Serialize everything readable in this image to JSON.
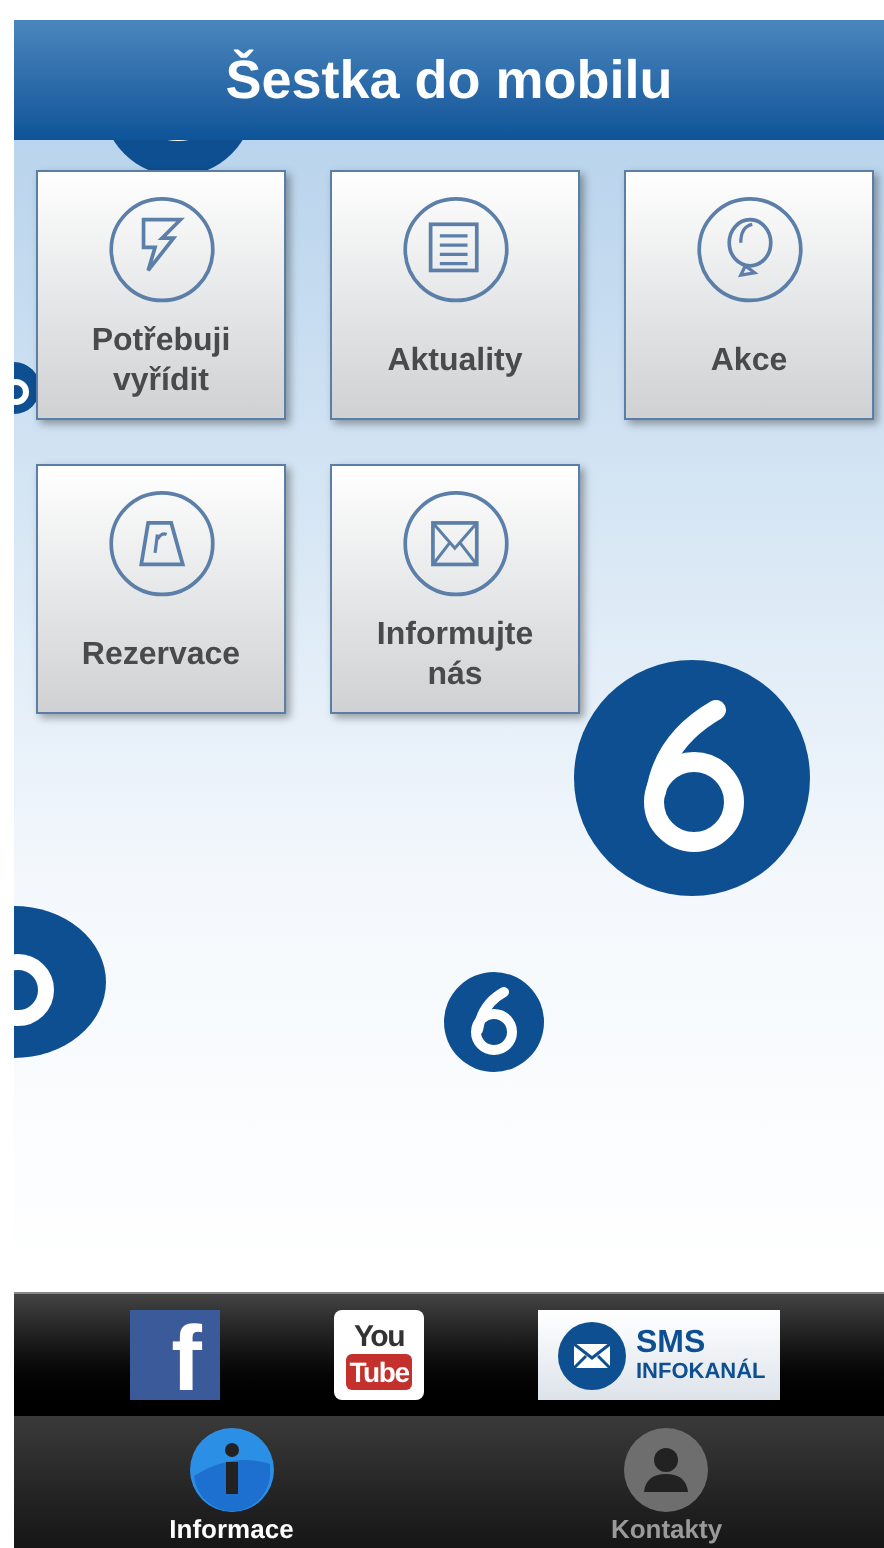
{
  "header": {
    "title": "Šestka do mobilu"
  },
  "tiles": [
    {
      "label": "Potřebuji vyřídit"
    },
    {
      "label": "Aktuality"
    },
    {
      "label": "Akce"
    },
    {
      "label": "Rezervace"
    },
    {
      "label": "Informujte nás"
    }
  ],
  "social_links": [
    {
      "lines": [
        "f"
      ]
    },
    {
      "lines": [
        "You",
        "Tube"
      ]
    },
    {
      "lines": [
        "SMS",
        "INFOKANÁL"
      ]
    }
  ],
  "tabs": [
    {
      "label": "Informace",
      "selected": true
    },
    {
      "label": "Kontakty",
      "selected": false
    }
  ]
}
